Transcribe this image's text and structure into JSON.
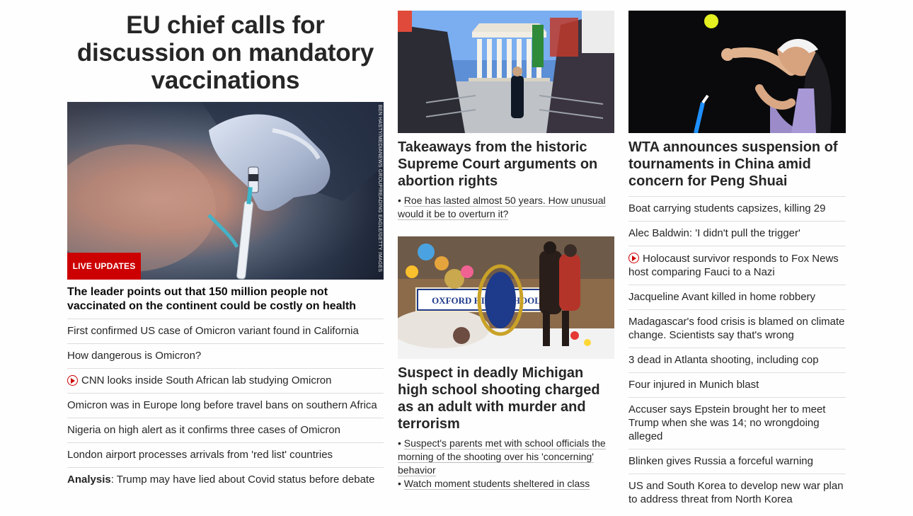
{
  "lead": {
    "title": "EU chief calls for discussion on mandatory vaccinations",
    "badge": "LIVE UPDATES",
    "photo_credit": "BEN HASTY/MEDIANEWS GROUP/READING EAGLE/GETTY IMAGES",
    "subheadline": "The leader points out that 150 million people not vaccinated on the continent could be costly on health",
    "items": [
      {
        "text": "First confirmed US case of Omicron variant found in California",
        "video": false
      },
      {
        "text": "How dangerous is Omicron?",
        "video": false
      },
      {
        "text": "CNN looks inside South African lab studying Omicron",
        "video": true
      },
      {
        "text": "Omicron was in Europe long before travel bans on southern Africa",
        "video": false
      },
      {
        "text": "Nigeria on high alert as it confirms three cases of Omicron",
        "video": false
      },
      {
        "text": "London airport processes arrivals from 'red list' countries",
        "video": false
      }
    ],
    "analysis_prefix": "Analysis",
    "analysis_text": ": Trump may have lied about Covid status before debate"
  },
  "col2": {
    "card1": {
      "title": "Takeaways from the historic Supreme Court arguments on abortion rights",
      "bullets": [
        "Roe has lasted almost 50 years. How unusual would it be to overturn it?"
      ]
    },
    "card2": {
      "title": "Suspect in deadly Michigan high school shooting charged as an adult with murder and terrorism",
      "sign_text": "OXFORD HIGH SCHOOL",
      "bullets": [
        "Suspect's parents met with school officials the morning of the shooting over his 'concerning' behavior",
        "Watch moment students sheltered in class"
      ]
    }
  },
  "col3": {
    "title": "WTA announces suspension of tournaments in China amid concern for Peng Shuai",
    "items": [
      {
        "text": "Boat carrying students capsizes, killing 29",
        "video": false
      },
      {
        "text": "Alec Baldwin: 'I didn't pull the trigger'",
        "video": false
      },
      {
        "text": "Holocaust survivor responds to Fox News host comparing Fauci to a Nazi",
        "video": true
      },
      {
        "text": "Jacqueline Avant killed in home robbery",
        "video": false
      },
      {
        "text": "Madagascar's food crisis is blamed on climate change. Scientists say that's wrong",
        "video": false
      },
      {
        "text": "3 dead in Atlanta shooting, including cop",
        "video": false
      },
      {
        "text": "Four injured in Munich blast",
        "video": false
      },
      {
        "text": "Accuser says Epstein brought her to meet Trump when she was 14; no wrongdoing alleged",
        "video": false
      },
      {
        "text": "Blinken gives Russia a forceful warning",
        "video": false
      },
      {
        "text": "US and South Korea to develop new war plan to address threat from North Korea",
        "video": false
      }
    ]
  },
  "colors": {
    "accent": "#cc0000",
    "text": "#262626",
    "divider": "#dedede"
  }
}
